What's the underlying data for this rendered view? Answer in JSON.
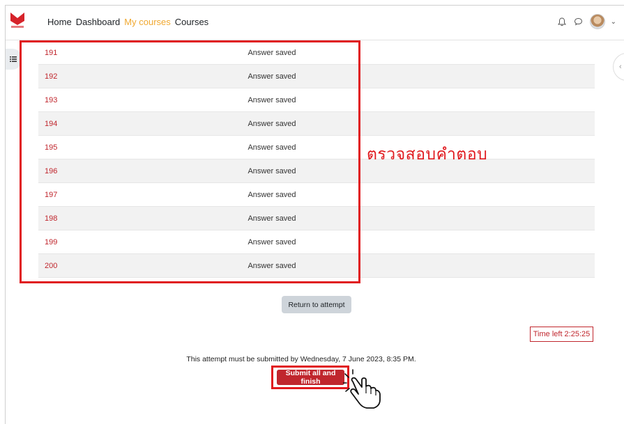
{
  "navbar": {
    "logo_name": "logo",
    "links": [
      {
        "label": "Home",
        "active": false
      },
      {
        "label": "Dashboard",
        "active": false
      },
      {
        "label": "My courses",
        "active": true
      },
      {
        "label": "Courses",
        "active": false
      }
    ],
    "icons": [
      "bell-icon",
      "chat-icon",
      "avatar",
      "chevron-down-icon"
    ]
  },
  "summary": {
    "rows": [
      {
        "question": "191",
        "status": "Answer saved"
      },
      {
        "question": "192",
        "status": "Answer saved"
      },
      {
        "question": "193",
        "status": "Answer saved"
      },
      {
        "question": "194",
        "status": "Answer saved"
      },
      {
        "question": "195",
        "status": "Answer saved"
      },
      {
        "question": "196",
        "status": "Answer saved"
      },
      {
        "question": "197",
        "status": "Answer saved"
      },
      {
        "question": "198",
        "status": "Answer saved"
      },
      {
        "question": "199",
        "status": "Answer saved"
      },
      {
        "question": "200",
        "status": "Answer saved"
      }
    ]
  },
  "annotation": {
    "text": "ตรวจสอบคำตอบ",
    "color": "#e0191e"
  },
  "actions": {
    "return_label": "Return to attempt",
    "time_left": "Time left 2:25:25",
    "deadline_text": "This attempt must be submitted by Wednesday, 7 June 2023, 8:35 PM.",
    "submit_label": "Submit all and finish"
  },
  "colors": {
    "accent": "#c0262d",
    "nav_active": "#f0a830",
    "highlight": "#e0191e"
  }
}
